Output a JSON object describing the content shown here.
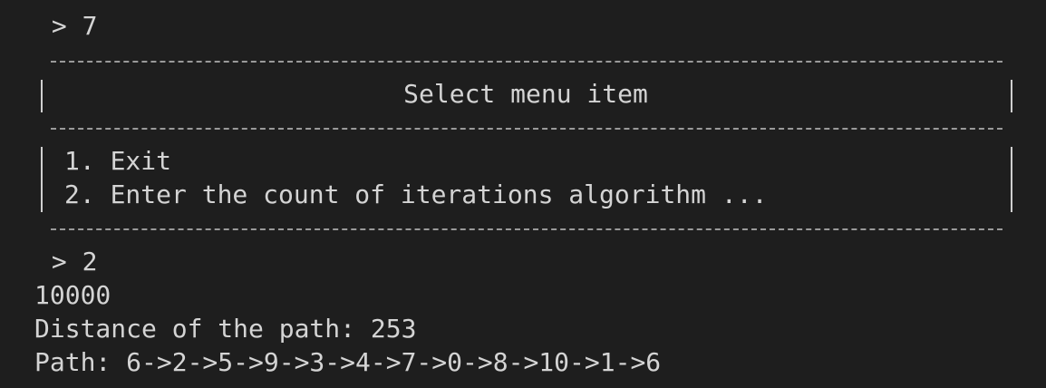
{
  "terminal": {
    "prompt1": " > 7",
    "menu": {
      "title": "Select menu item",
      "items": [
        "1. Exit",
        "2. Enter the count of iterations algorithm ..."
      ]
    },
    "prompt2": " > 2",
    "output": [
      "10000",
      "Distance of the path: 253",
      "Path: 6->2->5->9->3->4->7->0->8->10->1->6"
    ]
  }
}
